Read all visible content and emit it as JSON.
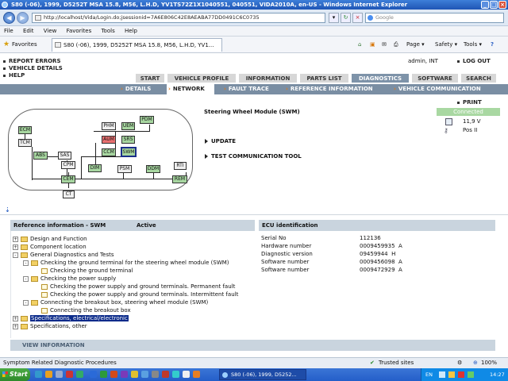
{
  "window": {
    "title": "S80 (-06), 1999, D5252T MSA 15.8, M56, L.H.D, YV1TS72Z1X1040551, 040551, VIDA2010A, en-US - Windows Internet Explorer"
  },
  "address": {
    "url": "http://localhost/Vida/Login.do;jsessionid=7A6E806C42E8AEABA77DD0491C6C0735",
    "search_placeholder": "Google"
  },
  "menu": [
    "File",
    "Edit",
    "View",
    "Favorites",
    "Tools",
    "Help"
  ],
  "favorites": {
    "label": "Favorites",
    "tab_title": "S80 (-06), 1999, D5252T MSA 15.8, M56, L.H.D, YV1...",
    "page_menu": "Page",
    "safety_menu": "Safety",
    "tools_menu": "Tools"
  },
  "topbar": {
    "links": [
      "REPORT ERRORS",
      "VEHICLE DETAILS",
      "HELP"
    ],
    "user": "admin, INT",
    "logout": "LOG OUT"
  },
  "main_tabs": [
    "START",
    "VEHICLE PROFILE",
    "INFORMATION",
    "PARTS LIST",
    "DIAGNOSTICS",
    "SOFTWARE",
    "SEARCH"
  ],
  "active_tab": "DIAGNOSTICS",
  "sub_tabs": [
    "DETAILS",
    "NETWORK",
    "FAULT TRACE",
    "REFERENCE INFORMATION",
    "VEHICLE COMMUNICATION"
  ],
  "active_sub_tab": "NETWORK",
  "network": {
    "module_title": "Steering Wheel Module (SWM)",
    "actions": [
      "UPDATE",
      "TEST COMMUNICATION TOOL"
    ],
    "ecus": [
      "ECM",
      "TCM",
      "ABS",
      "SAS",
      "CPM",
      "CEM",
      "CT",
      "PHM",
      "UEM",
      "PDM",
      "AUM",
      "SRS",
      "CCM",
      "SWM",
      "DIM",
      "PSM",
      "DDM",
      "RTI",
      "REM"
    ]
  },
  "status": {
    "print": "PRINT",
    "connected": "Connected",
    "voltage": "11,9 V",
    "key_position": "Pos II"
  },
  "reference": {
    "header": "Reference information - SWM",
    "state": "Active",
    "tree": [
      {
        "label": "Design and Function",
        "level": 0,
        "type": "folder",
        "toggle": "+"
      },
      {
        "label": "Component location",
        "level": 0,
        "type": "folder",
        "toggle": "+"
      },
      {
        "label": "General Diagnostics and Tests",
        "level": 0,
        "type": "folder",
        "toggle": "-"
      },
      {
        "label": "Checking the ground terminal for the steering wheel module (SWM)",
        "level": 1,
        "type": "folder",
        "toggle": "-"
      },
      {
        "label": "Checking the ground terminal",
        "level": 2,
        "type": "leaf",
        "toggle": ""
      },
      {
        "label": "Checking the power supply",
        "level": 1,
        "type": "folder",
        "toggle": "-"
      },
      {
        "label": "Checking the power supply and ground terminals. Permanent fault",
        "level": 2,
        "type": "leaf",
        "toggle": ""
      },
      {
        "label": "Checking the power supply and ground terminals. Intermittent fault",
        "level": 2,
        "type": "leaf",
        "toggle": ""
      },
      {
        "label": "Connecting the breakout box, steering wheel module (SWM)",
        "level": 1,
        "type": "folder",
        "toggle": "-"
      },
      {
        "label": "Connecting the breakout box",
        "level": 2,
        "type": "leaf",
        "toggle": ""
      },
      {
        "label": "Specifications, electrical/electronic",
        "level": 0,
        "type": "folder",
        "toggle": "+",
        "selected": true
      },
      {
        "label": "Specifications, other",
        "level": 0,
        "type": "folder",
        "toggle": "+"
      }
    ],
    "view_information": "VIEW INFORMATION"
  },
  "ecu_identification": {
    "header": "ECU identification",
    "rows": [
      {
        "label": "Serial No",
        "value": "112136"
      },
      {
        "label": "Hardware number",
        "value": "0009459935  A"
      },
      {
        "label": "Diagnostic version",
        "value": "09459944  H"
      },
      {
        "label": "Software number",
        "value": "0009456098  A"
      },
      {
        "label": "Software number",
        "value": "0009472929  A"
      }
    ]
  },
  "statusbar": {
    "text": "Symptom Related Diagnostic Procedures",
    "zone": "Trusted sites",
    "zoom": "100%"
  },
  "taskbar": {
    "start": "Start",
    "task": "S80 (-06), 1999, D5252...",
    "clock": "14:27",
    "lang": "EN"
  },
  "colors": {
    "subnav": "#7a8ea3",
    "active_tab": "#7e93a9",
    "ecu_green": "#a7d6a0",
    "ecu_red": "#e87070",
    "connected": "#a9d8a2"
  }
}
